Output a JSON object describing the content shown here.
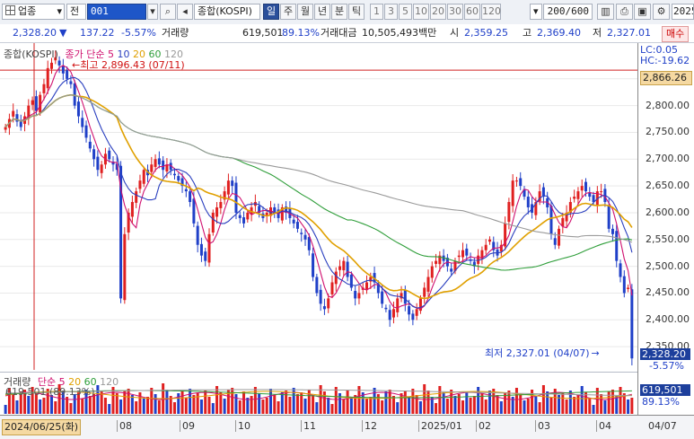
{
  "toolbar": {
    "category_label": "업종",
    "market_label": "전",
    "code": "001",
    "index_name": "종합(KOSPI)",
    "periods": [
      "일",
      "주",
      "월",
      "년",
      "분",
      "틱"
    ],
    "active_period": "일",
    "intervals": [
      "1",
      "3",
      "5",
      "10",
      "20",
      "30",
      "60",
      "120"
    ],
    "count_display": "200/600",
    "date_display": "2025/"
  },
  "info": {
    "price": "2,328.20",
    "change": "137.22",
    "change_pct": "-5.57%",
    "volume_label": "거래량",
    "volume": "619,501",
    "volume_pct": "89.13%",
    "amount_label": "거래대금",
    "amount": "10,505,493백만",
    "open_label": "시",
    "open": "2,359.25",
    "high_label": "고",
    "high": "2,369.40",
    "low_label": "저",
    "low": "2,327.01",
    "trade_button": "매수"
  },
  "legend": {
    "name": "종합(KOSPI)",
    "close_label": "종가",
    "simple_label": "단순",
    "ma_periods": [
      "5",
      "10",
      "20",
      "60",
      "120"
    ],
    "ma_colors": [
      "#d0106f",
      "#2a3fbf",
      "#e0a000",
      "#2f9e3a",
      "#9a9a9a"
    ]
  },
  "annotations": {
    "high_marker": "최고 2,896.43 (07/11)",
    "low_marker": "최저 2,327.01 (04/07)",
    "lc": "LC:0.05",
    "hc": "HC:-19.62",
    "ref_price": "2,866.26",
    "current_price": "2,328.20",
    "current_pct": "-5.57%"
  },
  "volume_legend": {
    "label": "거래량",
    "simple_label": "단순",
    "ma_periods": [
      "5",
      "20",
      "60",
      "120"
    ],
    "values_text": "619,501 (89.13%)"
  },
  "volume_axis": {
    "value": "619,501",
    "pct": "89.13%"
  },
  "x_axis": {
    "cursor_date": "2024/06/25(화)",
    "months": [
      "08",
      "09",
      "10",
      "11",
      "12",
      "2025/01",
      "02",
      "03",
      "04"
    ],
    "end_date": "04/07"
  },
  "colors": {
    "up": "#e02020",
    "down": "#2040c8",
    "accent": "#2a4f9b"
  },
  "chart_data": {
    "type": "candlestick",
    "y_ticks": [
      2850,
      2800,
      2750,
      2700,
      2650,
      2600,
      2550,
      2500,
      2450,
      2400,
      2350
    ],
    "ylim": [
      2320,
      2910
    ],
    "reference_line": 2866.26,
    "closes": [
      2760,
      2775,
      2790,
      2770,
      2760,
      2780,
      2800,
      2810,
      2790,
      2820,
      2840,
      2870,
      2880,
      2890,
      2875,
      2860,
      2850,
      2840,
      2800,
      2780,
      2760,
      2740,
      2720,
      2700,
      2680,
      2690,
      2710,
      2700,
      2690,
      2680,
      2440,
      2560,
      2600,
      2620,
      2640,
      2660,
      2680,
      2670,
      2690,
      2700,
      2690,
      2680,
      2690,
      2680,
      2670,
      2660,
      2650,
      2640,
      2620,
      2580,
      2540,
      2520,
      2510,
      2560,
      2600,
      2610,
      2620,
      2640,
      2660,
      2650,
      2600,
      2590,
      2580,
      2600,
      2610,
      2620,
      2600,
      2590,
      2600,
      2610,
      2600,
      2590,
      2610,
      2600,
      2590,
      2580,
      2570,
      2560,
      2550,
      2530,
      2480,
      2450,
      2430,
      2420,
      2440,
      2470,
      2490,
      2500,
      2510,
      2480,
      2460,
      2440,
      2450,
      2460,
      2470,
      2480,
      2470,
      2450,
      2430,
      2420,
      2400,
      2420,
      2440,
      2450,
      2430,
      2410,
      2400,
      2420,
      2440,
      2460,
      2480,
      2500,
      2510,
      2520,
      2510,
      2500,
      2490,
      2510,
      2520,
      2530,
      2520,
      2510,
      2500,
      2520,
      2530,
      2540,
      2550,
      2530,
      2520,
      2540,
      2580,
      2620,
      2660,
      2660,
      2650,
      2630,
      2610,
      2600,
      2620,
      2640,
      2630,
      2610,
      2560,
      2540,
      2570,
      2590,
      2600,
      2620,
      2630,
      2640,
      2650,
      2640,
      2630,
      2620,
      2640,
      2640,
      2620,
      2570,
      2560,
      2510,
      2480,
      2450,
      2460,
      2328
    ]
  }
}
